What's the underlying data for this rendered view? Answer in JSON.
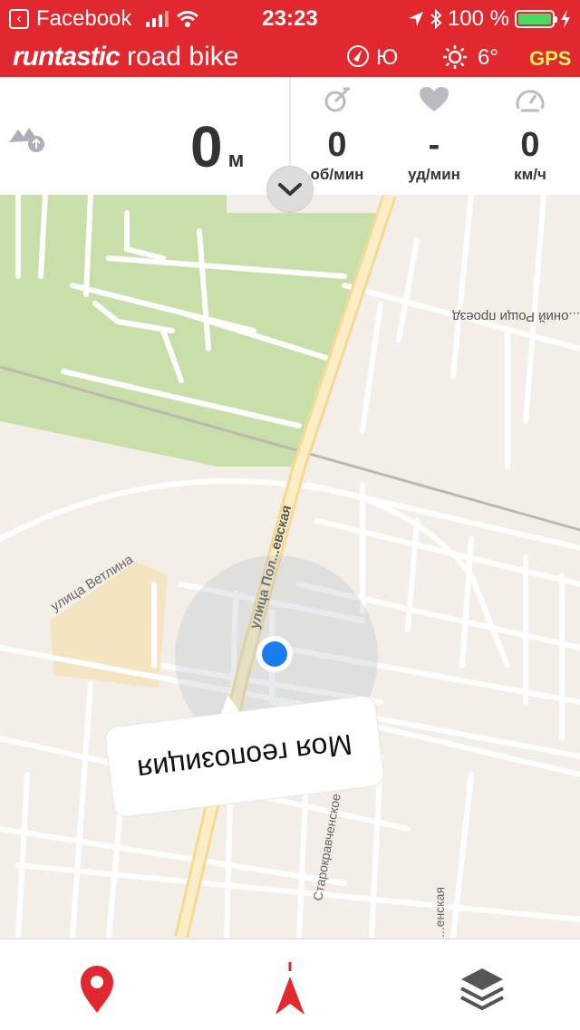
{
  "status_bar": {
    "back_app": "Facebook",
    "time": "23:23",
    "battery": "100 %"
  },
  "app_bar": {
    "brand_part1": "runtastic",
    "brand_part2": "road bike",
    "direction": "Ю",
    "temperature": "6°",
    "gps_label": "GPS"
  },
  "stats": {
    "distance": {
      "value": "0",
      "unit": "м"
    },
    "cadence": {
      "value": "0",
      "unit": "об/мин"
    },
    "heart_rate": {
      "value": "-",
      "unit": "уд/мин"
    },
    "speed": {
      "value": "0",
      "unit": "км/ч"
    }
  },
  "map": {
    "callout": "Моя геопозиция",
    "street_labels": {
      "street1": "улица Ветлина",
      "street2": "улица Пол...евская",
      "street3": "Старокравченское шоссе",
      "street4": "...енская",
      "street5": "...оний Рощи проезд"
    }
  },
  "colors": {
    "brand_red": "#e0282e",
    "park_green": "#c8dfaa",
    "location_blue": "#1b7cf0",
    "battery_green": "#4cd964"
  },
  "icons": {
    "bottom_left": "map-pin-icon",
    "bottom_center": "navigation-arrow-icon",
    "bottom_right": "layers-icon"
  }
}
